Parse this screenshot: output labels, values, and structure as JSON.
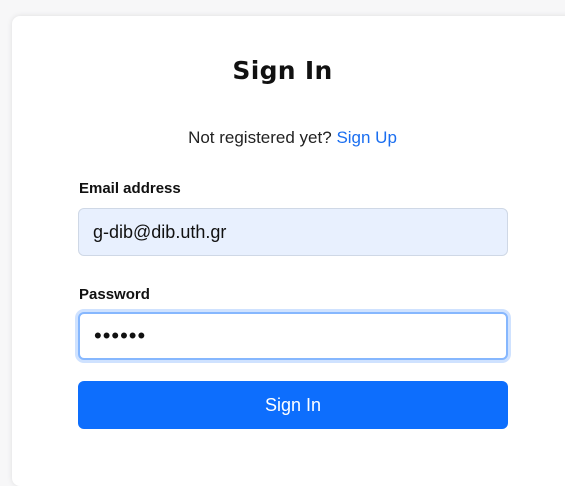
{
  "form": {
    "title": "Sign In",
    "register_prompt": "Not registered yet?",
    "signup_link": "Sign Up",
    "email_label": "Email address",
    "email_value": "g-dib@dib.uth.gr",
    "password_label": "Password",
    "password_value": "••••••",
    "submit_label": "Sign In"
  },
  "colors": {
    "accent": "#0d6efd",
    "link": "#1a6ef0",
    "autofill_bg": "#e8f0fe",
    "focus_border": "#86b7fe"
  }
}
